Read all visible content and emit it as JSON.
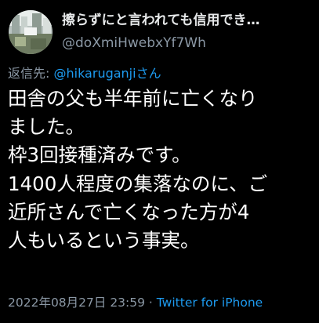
{
  "author": {
    "display_name": "擦らずにと言われても信用でき…",
    "handle": "@doXmiHwebxYf7Wh"
  },
  "reply": {
    "prefix": "返信先: ",
    "mention": "@hikaruganjiさん"
  },
  "body_lines": [
    "田舎の父も半年前に亡くなり",
    "ました。",
    "枠3回接種済みです。",
    "1400人程度の集落なのに、ご",
    "近所さんで亡くなった方が4",
    "人もいるという事実。"
  ],
  "meta": {
    "timestamp": "2022年08月27日 23:59",
    "separator": " · ",
    "source": "Twitter for iPhone"
  },
  "colors": {
    "background": "#000000",
    "text": "#ffffff",
    "secondary": "#8b98a5",
    "accent": "#1d9bf0"
  }
}
